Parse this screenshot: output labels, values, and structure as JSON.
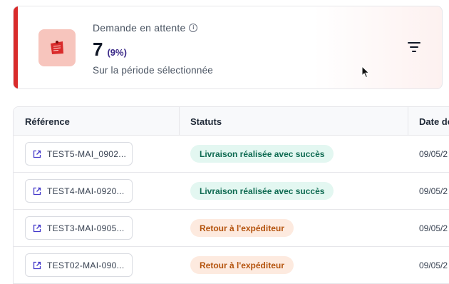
{
  "kpi": {
    "label": "Demande en attente",
    "value": "7",
    "percent": "(9%)",
    "subtitle": "Sur la période sélectionnée",
    "accent_color": "#d92b2b",
    "icon": "pinned-note-icon"
  },
  "table": {
    "columns": [
      "Référence",
      "Statuts",
      "Date de"
    ],
    "rows": [
      {
        "reference": "TEST5-MAI_0902...",
        "status": "Livraison réalisée avec succès",
        "status_type": "success",
        "date": "09/05/2"
      },
      {
        "reference": "TEST4-MAI-0920...",
        "status": "Livraison réalisée avec succès",
        "status_type": "success",
        "date": "09/05/2"
      },
      {
        "reference": "TEST3-MAI-0905...",
        "status": "Retour à l'expéditeur",
        "status_type": "return",
        "date": "09/05/2"
      },
      {
        "reference": "TEST02-MAI-090...",
        "status": "Retour à l'expéditeur",
        "status_type": "return",
        "date": "09/05/2"
      }
    ]
  },
  "colors": {
    "success_bg": "#e3f7f1",
    "success_text": "#0f6b52",
    "return_bg": "#fdeadf",
    "return_text": "#b4530d"
  }
}
